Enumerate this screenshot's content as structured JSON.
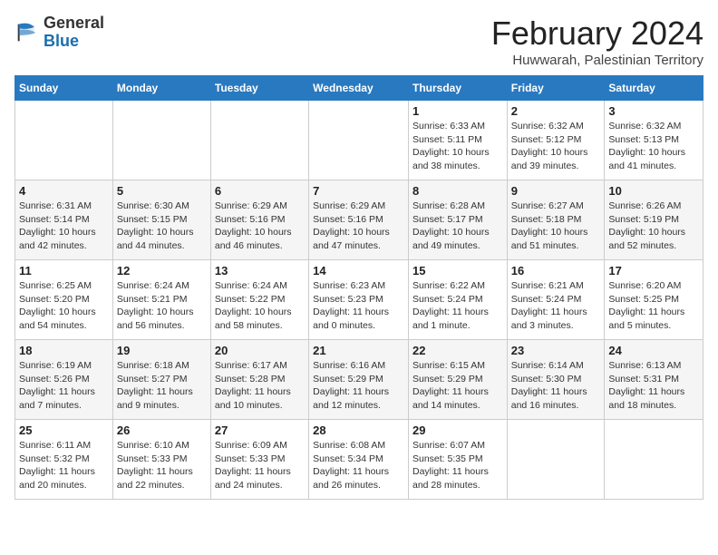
{
  "header": {
    "logo_general": "General",
    "logo_blue": "Blue",
    "month_title": "February 2024",
    "location": "Huwwarah, Palestinian Territory"
  },
  "days_of_week": [
    "Sunday",
    "Monday",
    "Tuesday",
    "Wednesday",
    "Thursday",
    "Friday",
    "Saturday"
  ],
  "weeks": [
    [
      {
        "day": "",
        "info": ""
      },
      {
        "day": "",
        "info": ""
      },
      {
        "day": "",
        "info": ""
      },
      {
        "day": "",
        "info": ""
      },
      {
        "day": "1",
        "info": "Sunrise: 6:33 AM\nSunset: 5:11 PM\nDaylight: 10 hours\nand 38 minutes."
      },
      {
        "day": "2",
        "info": "Sunrise: 6:32 AM\nSunset: 5:12 PM\nDaylight: 10 hours\nand 39 minutes."
      },
      {
        "day": "3",
        "info": "Sunrise: 6:32 AM\nSunset: 5:13 PM\nDaylight: 10 hours\nand 41 minutes."
      }
    ],
    [
      {
        "day": "4",
        "info": "Sunrise: 6:31 AM\nSunset: 5:14 PM\nDaylight: 10 hours\nand 42 minutes."
      },
      {
        "day": "5",
        "info": "Sunrise: 6:30 AM\nSunset: 5:15 PM\nDaylight: 10 hours\nand 44 minutes."
      },
      {
        "day": "6",
        "info": "Sunrise: 6:29 AM\nSunset: 5:16 PM\nDaylight: 10 hours\nand 46 minutes."
      },
      {
        "day": "7",
        "info": "Sunrise: 6:29 AM\nSunset: 5:16 PM\nDaylight: 10 hours\nand 47 minutes."
      },
      {
        "day": "8",
        "info": "Sunrise: 6:28 AM\nSunset: 5:17 PM\nDaylight: 10 hours\nand 49 minutes."
      },
      {
        "day": "9",
        "info": "Sunrise: 6:27 AM\nSunset: 5:18 PM\nDaylight: 10 hours\nand 51 minutes."
      },
      {
        "day": "10",
        "info": "Sunrise: 6:26 AM\nSunset: 5:19 PM\nDaylight: 10 hours\nand 52 minutes."
      }
    ],
    [
      {
        "day": "11",
        "info": "Sunrise: 6:25 AM\nSunset: 5:20 PM\nDaylight: 10 hours\nand 54 minutes."
      },
      {
        "day": "12",
        "info": "Sunrise: 6:24 AM\nSunset: 5:21 PM\nDaylight: 10 hours\nand 56 minutes."
      },
      {
        "day": "13",
        "info": "Sunrise: 6:24 AM\nSunset: 5:22 PM\nDaylight: 10 hours\nand 58 minutes."
      },
      {
        "day": "14",
        "info": "Sunrise: 6:23 AM\nSunset: 5:23 PM\nDaylight: 11 hours\nand 0 minutes."
      },
      {
        "day": "15",
        "info": "Sunrise: 6:22 AM\nSunset: 5:24 PM\nDaylight: 11 hours\nand 1 minute."
      },
      {
        "day": "16",
        "info": "Sunrise: 6:21 AM\nSunset: 5:24 PM\nDaylight: 11 hours\nand 3 minutes."
      },
      {
        "day": "17",
        "info": "Sunrise: 6:20 AM\nSunset: 5:25 PM\nDaylight: 11 hours\nand 5 minutes."
      }
    ],
    [
      {
        "day": "18",
        "info": "Sunrise: 6:19 AM\nSunset: 5:26 PM\nDaylight: 11 hours\nand 7 minutes."
      },
      {
        "day": "19",
        "info": "Sunrise: 6:18 AM\nSunset: 5:27 PM\nDaylight: 11 hours\nand 9 minutes."
      },
      {
        "day": "20",
        "info": "Sunrise: 6:17 AM\nSunset: 5:28 PM\nDaylight: 11 hours\nand 10 minutes."
      },
      {
        "day": "21",
        "info": "Sunrise: 6:16 AM\nSunset: 5:29 PM\nDaylight: 11 hours\nand 12 minutes."
      },
      {
        "day": "22",
        "info": "Sunrise: 6:15 AM\nSunset: 5:29 PM\nDaylight: 11 hours\nand 14 minutes."
      },
      {
        "day": "23",
        "info": "Sunrise: 6:14 AM\nSunset: 5:30 PM\nDaylight: 11 hours\nand 16 minutes."
      },
      {
        "day": "24",
        "info": "Sunrise: 6:13 AM\nSunset: 5:31 PM\nDaylight: 11 hours\nand 18 minutes."
      }
    ],
    [
      {
        "day": "25",
        "info": "Sunrise: 6:11 AM\nSunset: 5:32 PM\nDaylight: 11 hours\nand 20 minutes."
      },
      {
        "day": "26",
        "info": "Sunrise: 6:10 AM\nSunset: 5:33 PM\nDaylight: 11 hours\nand 22 minutes."
      },
      {
        "day": "27",
        "info": "Sunrise: 6:09 AM\nSunset: 5:33 PM\nDaylight: 11 hours\nand 24 minutes."
      },
      {
        "day": "28",
        "info": "Sunrise: 6:08 AM\nSunset: 5:34 PM\nDaylight: 11 hours\nand 26 minutes."
      },
      {
        "day": "29",
        "info": "Sunrise: 6:07 AM\nSunset: 5:35 PM\nDaylight: 11 hours\nand 28 minutes."
      },
      {
        "day": "",
        "info": ""
      },
      {
        "day": "",
        "info": ""
      }
    ]
  ]
}
